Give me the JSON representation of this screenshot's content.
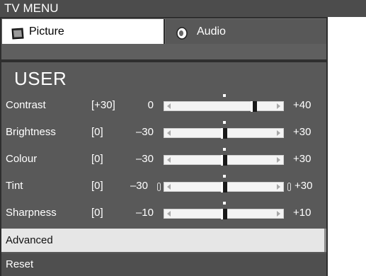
{
  "title": "TV MENU",
  "tabs": [
    {
      "label": "Picture",
      "icon": "picture-icon"
    },
    {
      "label": "Audio",
      "icon": "speaker-icon"
    }
  ],
  "panel": {
    "heading": "USER",
    "rows": [
      {
        "name": "Contrast",
        "current": "[+30]",
        "min": "0",
        "max": "+40",
        "level": 0.75
      },
      {
        "name": "Brightness",
        "current": "[0]",
        "min": "–30",
        "max": "+30",
        "level": 0.5
      },
      {
        "name": "Colour",
        "current": "[0]",
        "min": "–30",
        "max": "+30",
        "level": 0.5
      },
      {
        "name": "Tint",
        "current": "[0]",
        "min": "–30",
        "max": "+30",
        "level": 0.5
      },
      {
        "name": "Sharpness",
        "current": "[0]",
        "min": "–10",
        "max": "+10",
        "level": 0.5
      }
    ],
    "advanced_label": "Advanced",
    "reset_label": "Reset"
  },
  "colors": {
    "title_bar": "#4c4c4c",
    "panel": "#595959",
    "highlight": "#e6e6e6"
  }
}
